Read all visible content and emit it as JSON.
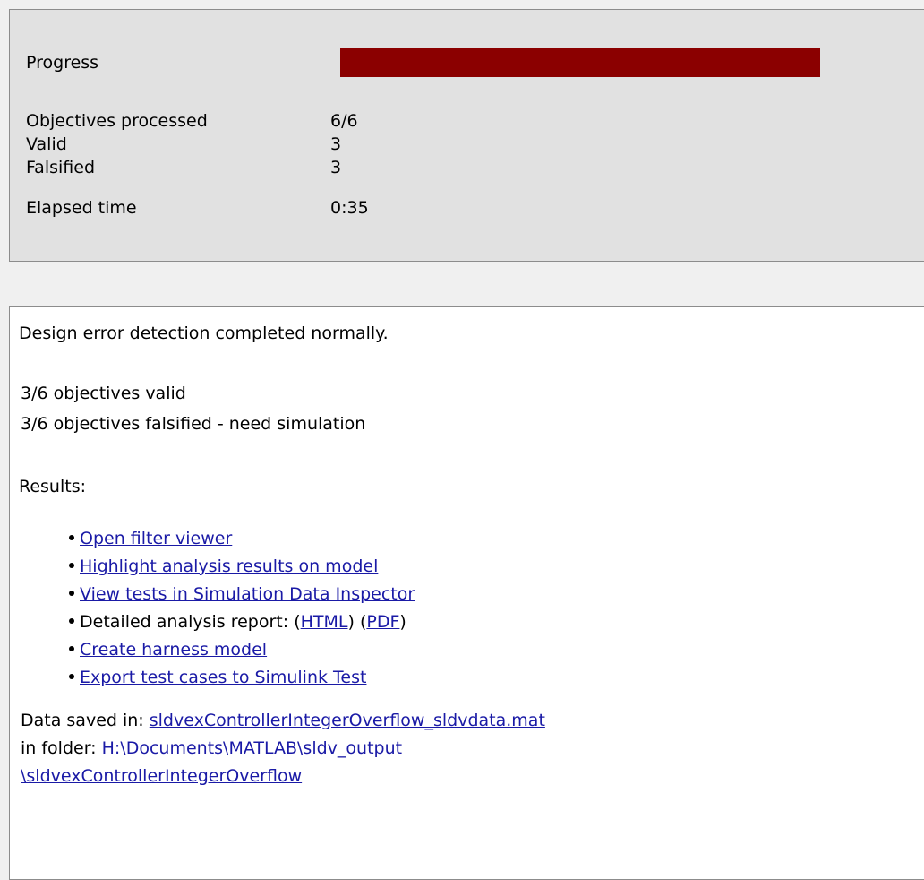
{
  "status": {
    "progress_label": "Progress",
    "progress_fraction": 1.0,
    "progress_color": "#8b0000",
    "rows": [
      {
        "label": "Objectives processed",
        "value": "6/6"
      },
      {
        "label": "Valid",
        "value": "3"
      },
      {
        "label": "Falsified",
        "value": "3"
      },
      {
        "label": "Elapsed time",
        "value": "0:35"
      }
    ]
  },
  "results": {
    "completion_message": "Design error detection completed normally.",
    "valid_summary": "3/6 objectives valid",
    "falsified_summary": "3/6 objectives falsified - need simulation",
    "results_heading": "Results:",
    "links": {
      "open_filter_viewer": "Open filter viewer",
      "highlight_results": "Highlight analysis results on model",
      "view_tests_sdi": "View tests in Simulation Data Inspector",
      "report_prefix": "Detailed analysis report: (",
      "report_html": "HTML",
      "report_mid": ") (",
      "report_pdf": "PDF",
      "report_suffix": ")",
      "create_harness": "Create harness model",
      "export_tests": "Export test cases to Simulink Test"
    },
    "data_saved_label": "Data saved in: ",
    "data_file": "sldvexControllerIntegerOverflow_sldvdata.mat",
    "folder_label": "in folder: ",
    "folder_path_line1": "H:\\Documents\\MATLAB\\sldv_output",
    "folder_path_line2": "\\sldvexControllerIntegerOverflow",
    "link_color": "#1a1aa6"
  }
}
